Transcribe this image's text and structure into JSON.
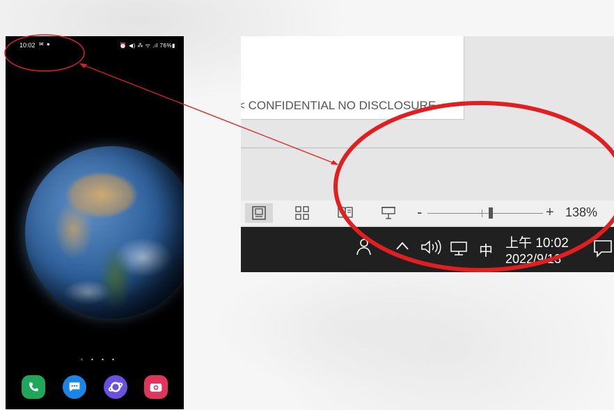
{
  "phone": {
    "status_time": "10:02",
    "status_left_icons": "✉ ●",
    "status_right_icons": "⏰ ◀) ⁂ ᯤ .ıl 76%▮",
    "page_indicator": "▫ • • •",
    "dock": [
      "phone-icon",
      "messages-icon",
      "internet-browser-icon",
      "camera-icon"
    ]
  },
  "document": {
    "footer_text": "< CONFIDENTIAL NO DISCLOSURE"
  },
  "status_bar": {
    "views": [
      "print-layout-icon",
      "web-layout-icon",
      "read-mode-icon",
      "presentation-icon"
    ],
    "zoom_out_label": "-",
    "zoom_in_label": "+",
    "zoom_level": "138%"
  },
  "taskbar": {
    "ime": "中",
    "time": "上午 10:02",
    "date": "2022/9/13"
  },
  "colors": {
    "annotation_red": "#e02020",
    "taskbar_bg": "#202020",
    "status_bar_bg": "#f0f0f0"
  }
}
